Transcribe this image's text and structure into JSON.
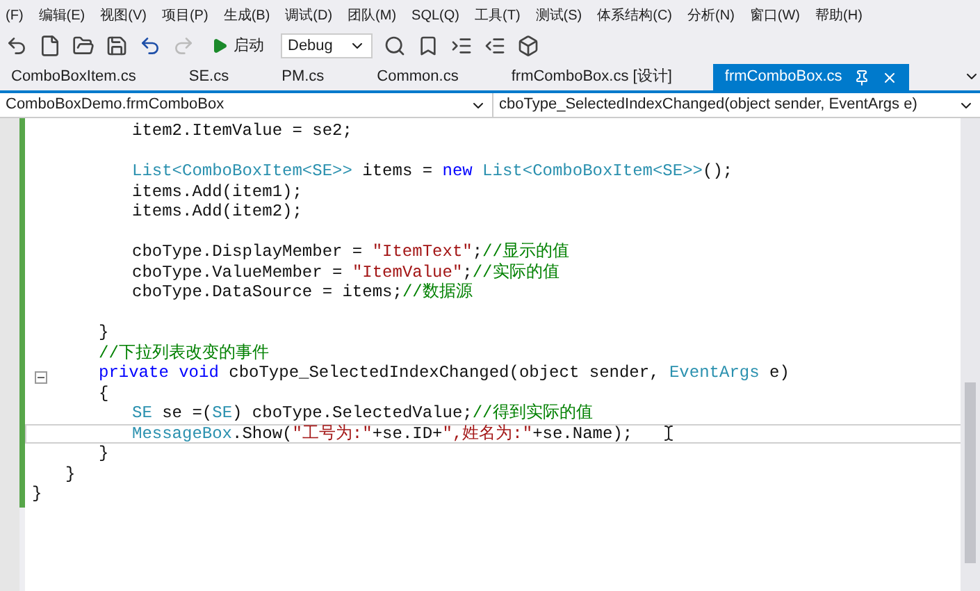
{
  "menu_bar": [
    "(F)",
    "编辑(E)",
    "视图(V)",
    "项目(P)",
    "生成(B)",
    "调试(D)",
    "团队(M)",
    "SQL(Q)",
    "工具(T)",
    "测试(S)",
    "体系结构(C)",
    "分析(N)",
    "窗口(W)",
    "帮助(H)"
  ],
  "toolbar": {
    "start_button": "启动",
    "configuration": "Debug"
  },
  "tabs": [
    {
      "label": "ComboBoxItem.cs",
      "selected": false
    },
    {
      "label": "SE.cs",
      "selected": false
    },
    {
      "label": "PM.cs",
      "selected": false
    },
    {
      "label": "Common.cs",
      "selected": false
    },
    {
      "label": "frmComboBox.cs [设计]",
      "selected": false
    },
    {
      "label": "frmComboBox.cs",
      "selected": true
    }
  ],
  "navigation_bar": {
    "type": "ComboBoxDemo.frmComboBox",
    "member": "cboType_SelectedIndexChanged(object sender, EventArgs e)"
  },
  "code": [
    {
      "kind": "group",
      "children": [
        {
          "kind": "group",
          "children": [
            {
              "kind": "group",
              "children": [
                {
                  "kind": "line",
                  "tokens": [
                    {
                      "kind": "plain",
                      "text": "item2.ItemValue = se2;"
                    }
                  ]
                },
                {
                  "kind": "blank"
                },
                {
                  "kind": "line",
                  "tokens": [
                    {
                      "kind": "type",
                      "text": "List<ComboBoxItem<SE>>"
                    },
                    {
                      "kind": "plain",
                      "text": " items = "
                    },
                    {
                      "kind": "keyword",
                      "text": "new"
                    },
                    {
                      "kind": "type",
                      "text": " List<ComboBoxItem<SE>>"
                    },
                    {
                      "kind": "plain",
                      "text": "();"
                    }
                  ]
                },
                {
                  "kind": "line",
                  "tokens": [
                    {
                      "kind": "plain",
                      "text": "items.Add(item1);"
                    }
                  ]
                },
                {
                  "kind": "line",
                  "tokens": [
                    {
                      "kind": "plain",
                      "text": "items.Add(item2);"
                    }
                  ]
                },
                {
                  "kind": "blank"
                },
                {
                  "kind": "line",
                  "tokens": [
                    {
                      "kind": "plain",
                      "text": "cboType.DisplayMember = "
                    },
                    {
                      "kind": "string",
                      "text": "\"ItemText\""
                    },
                    {
                      "kind": "plain",
                      "text": ";"
                    },
                    {
                      "kind": "comment",
                      "text": "//显示的值"
                    }
                  ]
                },
                {
                  "kind": "line",
                  "tokens": [
                    {
                      "kind": "plain",
                      "text": "cboType.ValueMember = "
                    },
                    {
                      "kind": "string",
                      "text": "\"ItemValue\""
                    },
                    {
                      "kind": "plain",
                      "text": ";"
                    },
                    {
                      "kind": "comment",
                      "text": "//实际的值"
                    }
                  ]
                },
                {
                  "kind": "line",
                  "tokens": [
                    {
                      "kind": "plain",
                      "text": "cboType.DataSource = items;"
                    },
                    {
                      "kind": "comment",
                      "text": "//数据源"
                    }
                  ]
                },
                {
                  "kind": "blank"
                }
              ]
            },
            {
              "kind": "line",
              "tokens": [
                {
                  "kind": "plain",
                  "text": "}"
                }
              ]
            },
            {
              "kind": "line",
              "tokens": [
                {
                  "kind": "comment",
                  "text": "//下拉列表改变的事件"
                }
              ]
            },
            {
              "kind": "line",
              "fold": true,
              "tokens": [
                {
                  "kind": "keyword",
                  "text": "private void"
                },
                {
                  "kind": "plain",
                  "text": " cboType_SelectedIndexChanged(object sender, "
                },
                {
                  "kind": "type",
                  "text": "EventArgs"
                },
                {
                  "kind": "plain",
                  "text": " e)"
                }
              ]
            },
            {
              "kind": "line",
              "tokens": [
                {
                  "kind": "plain",
                  "text": "{"
                }
              ]
            },
            {
              "kind": "group",
              "children": [
                {
                  "kind": "line",
                  "tokens": [
                    {
                      "kind": "type",
                      "text": "SE"
                    },
                    {
                      "kind": "plain",
                      "text": " se =("
                    },
                    {
                      "kind": "type",
                      "text": "SE"
                    },
                    {
                      "kind": "plain",
                      "text": ") cboType.SelectedValue;"
                    },
                    {
                      "kind": "comment",
                      "text": "//得到实际的值"
                    }
                  ]
                },
                {
                  "kind": "line",
                  "current": true,
                  "tokens": [
                    {
                      "kind": "type",
                      "text": "MessageBox"
                    },
                    {
                      "kind": "plain",
                      "text": ".Show("
                    },
                    {
                      "kind": "string",
                      "text": "\"工号为:\""
                    },
                    {
                      "kind": "plain",
                      "text": "+se.ID+"
                    },
                    {
                      "kind": "string",
                      "text": "\",姓名为:\""
                    },
                    {
                      "kind": "plain",
                      "text": "+se.Name);"
                    }
                  ]
                }
              ]
            },
            {
              "kind": "line",
              "tokens": [
                {
                  "kind": "plain",
                  "text": "}"
                }
              ]
            }
          ]
        },
        {
          "kind": "line",
          "tokens": [
            {
              "kind": "plain",
              "text": "}"
            }
          ]
        }
      ]
    },
    {
      "kind": "line",
      "tokens": [
        {
          "kind": "plain",
          "text": "}"
        }
      ]
    }
  ]
}
